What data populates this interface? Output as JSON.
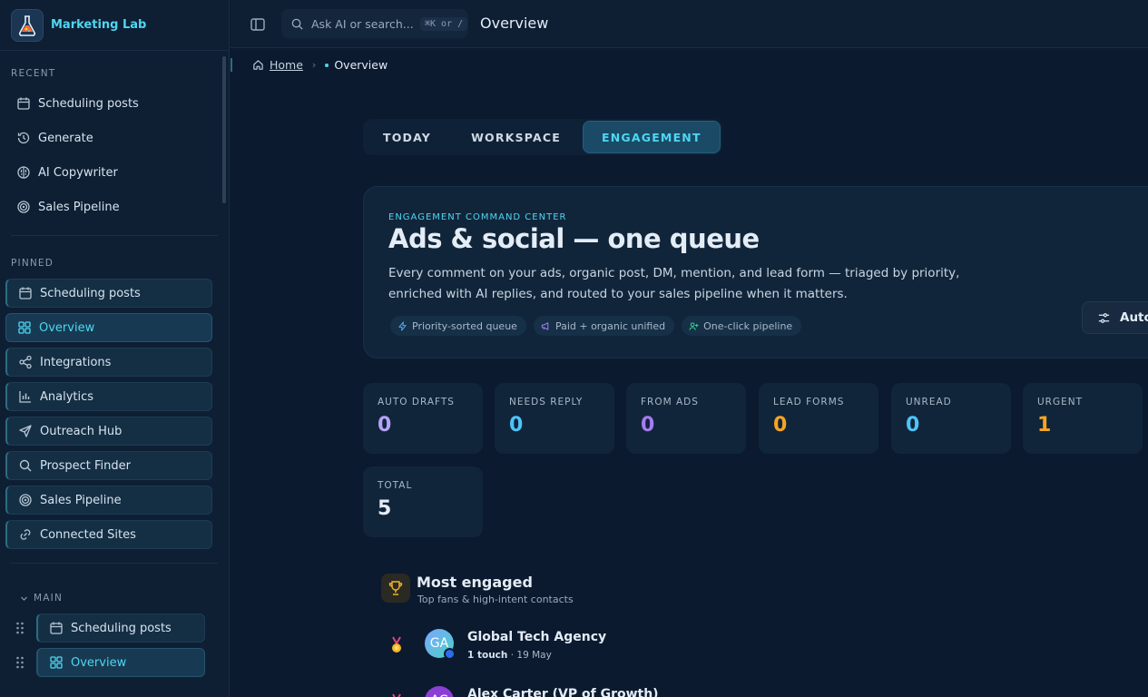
{
  "app": {
    "name": "Marketing Lab"
  },
  "sidebar": {
    "recent_label": "RECENT",
    "recent": [
      {
        "label": "Scheduling posts",
        "icon": "calendar-icon"
      },
      {
        "label": "Generate",
        "icon": "history-icon"
      },
      {
        "label": "AI Copywriter",
        "icon": "brain-icon"
      },
      {
        "label": "Sales Pipeline",
        "icon": "target-icon"
      }
    ],
    "pinned_label": "PINNED",
    "pinned": [
      {
        "label": "Scheduling posts",
        "icon": "calendar-icon"
      },
      {
        "label": "Overview",
        "icon": "dashboard-icon",
        "active": true
      },
      {
        "label": "Integrations",
        "icon": "share-icon"
      },
      {
        "label": "Analytics",
        "icon": "bar-chart-icon"
      },
      {
        "label": "Outreach Hub",
        "icon": "send-icon"
      },
      {
        "label": "Prospect Finder",
        "icon": "search-icon"
      },
      {
        "label": "Sales Pipeline",
        "icon": "target-icon"
      },
      {
        "label": "Connected Sites",
        "icon": "link-icon"
      }
    ],
    "main_label": "MAIN",
    "main": [
      {
        "label": "Scheduling posts",
        "icon": "calendar-icon"
      },
      {
        "label": "Overview",
        "icon": "dashboard-icon",
        "active": true
      }
    ]
  },
  "topbar": {
    "search_placeholder": "Ask AI or search...",
    "shortcut": "⌘K or /",
    "title": "Overview"
  },
  "breadcrumb": {
    "home": "Home",
    "current": "Overview"
  },
  "tabs": [
    {
      "label": "TODAY"
    },
    {
      "label": "WORKSPACE"
    },
    {
      "label": "ENGAGEMENT",
      "active": true
    }
  ],
  "hero": {
    "kicker": "ENGAGEMENT COMMAND CENTER",
    "title": "Ads & social — one queue",
    "description": "Every comment on your ads, organic post, DM, mention, and lead form — triaged by priority, enriched with AI replies, and routed to your sales pipeline when it matters.",
    "chips": [
      {
        "label": "Priority-sorted queue",
        "icon": "bolt-icon",
        "color": "#4fa8f2"
      },
      {
        "label": "Paid + organic unified",
        "icon": "megaphone-icon",
        "color": "#a67cf2"
      },
      {
        "label": "One-click pipeline",
        "icon": "user-plus-icon",
        "color": "#3ecf8e"
      }
    ],
    "auto_button": "Auto"
  },
  "stats": [
    {
      "label": "AUTO DRAFTS",
      "value": "0",
      "color": "#b3a4f7"
    },
    {
      "label": "NEEDS REPLY",
      "value": "0",
      "color": "#4fc3f7"
    },
    {
      "label": "FROM ADS",
      "value": "0",
      "color": "#a67cf2"
    },
    {
      "label": "LEAD FORMS",
      "value": "0",
      "color": "#f5a524"
    },
    {
      "label": "UNREAD",
      "value": "0",
      "color": "#4fc3f7"
    },
    {
      "label": "URGENT",
      "value": "1",
      "color": "#f5a524"
    },
    {
      "label": "TOTAL",
      "value": "5",
      "color": "#e4ecf6"
    }
  ],
  "most_engaged": {
    "title": "Most engaged",
    "subtitle": "Top fans & high-intent contacts",
    "rows": [
      {
        "initials": "GA",
        "name": "Global Tech Agency",
        "touches": "1 touch",
        "date": "· 19 May"
      },
      {
        "initials": "AC",
        "name": "Alex Carter (VP of Growth)",
        "touches": "",
        "date": ""
      }
    ]
  }
}
